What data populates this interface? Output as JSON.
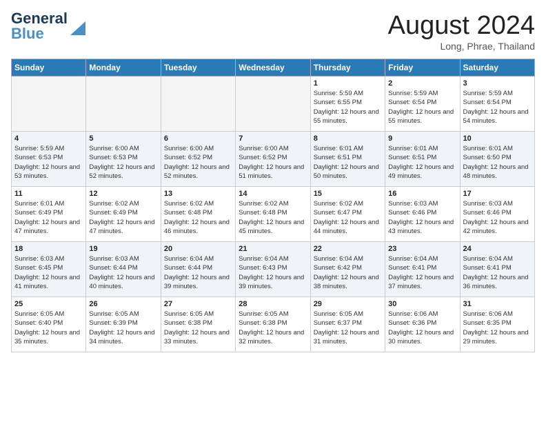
{
  "header": {
    "logo_line1": "General",
    "logo_line2": "Blue",
    "month_year": "August 2024",
    "location": "Long, Phrae, Thailand"
  },
  "days_of_week": [
    "Sunday",
    "Monday",
    "Tuesday",
    "Wednesday",
    "Thursday",
    "Friday",
    "Saturday"
  ],
  "weeks": [
    [
      {
        "day": "",
        "sunrise": "",
        "sunset": "",
        "daylight": ""
      },
      {
        "day": "",
        "sunrise": "",
        "sunset": "",
        "daylight": ""
      },
      {
        "day": "",
        "sunrise": "",
        "sunset": "",
        "daylight": ""
      },
      {
        "day": "",
        "sunrise": "",
        "sunset": "",
        "daylight": ""
      },
      {
        "day": "1",
        "sunrise": "Sunrise: 5:59 AM",
        "sunset": "Sunset: 6:55 PM",
        "daylight": "Daylight: 12 hours and 55 minutes."
      },
      {
        "day": "2",
        "sunrise": "Sunrise: 5:59 AM",
        "sunset": "Sunset: 6:54 PM",
        "daylight": "Daylight: 12 hours and 55 minutes."
      },
      {
        "day": "3",
        "sunrise": "Sunrise: 5:59 AM",
        "sunset": "Sunset: 6:54 PM",
        "daylight": "Daylight: 12 hours and 54 minutes."
      }
    ],
    [
      {
        "day": "4",
        "sunrise": "Sunrise: 5:59 AM",
        "sunset": "Sunset: 6:53 PM",
        "daylight": "Daylight: 12 hours and 53 minutes."
      },
      {
        "day": "5",
        "sunrise": "Sunrise: 6:00 AM",
        "sunset": "Sunset: 6:53 PM",
        "daylight": "Daylight: 12 hours and 52 minutes."
      },
      {
        "day": "6",
        "sunrise": "Sunrise: 6:00 AM",
        "sunset": "Sunset: 6:52 PM",
        "daylight": "Daylight: 12 hours and 52 minutes."
      },
      {
        "day": "7",
        "sunrise": "Sunrise: 6:00 AM",
        "sunset": "Sunset: 6:52 PM",
        "daylight": "Daylight: 12 hours and 51 minutes."
      },
      {
        "day": "8",
        "sunrise": "Sunrise: 6:01 AM",
        "sunset": "Sunset: 6:51 PM",
        "daylight": "Daylight: 12 hours and 50 minutes."
      },
      {
        "day": "9",
        "sunrise": "Sunrise: 6:01 AM",
        "sunset": "Sunset: 6:51 PM",
        "daylight": "Daylight: 12 hours and 49 minutes."
      },
      {
        "day": "10",
        "sunrise": "Sunrise: 6:01 AM",
        "sunset": "Sunset: 6:50 PM",
        "daylight": "Daylight: 12 hours and 48 minutes."
      }
    ],
    [
      {
        "day": "11",
        "sunrise": "Sunrise: 6:01 AM",
        "sunset": "Sunset: 6:49 PM",
        "daylight": "Daylight: 12 hours and 47 minutes."
      },
      {
        "day": "12",
        "sunrise": "Sunrise: 6:02 AM",
        "sunset": "Sunset: 6:49 PM",
        "daylight": "Daylight: 12 hours and 47 minutes."
      },
      {
        "day": "13",
        "sunrise": "Sunrise: 6:02 AM",
        "sunset": "Sunset: 6:48 PM",
        "daylight": "Daylight: 12 hours and 46 minutes."
      },
      {
        "day": "14",
        "sunrise": "Sunrise: 6:02 AM",
        "sunset": "Sunset: 6:48 PM",
        "daylight": "Daylight: 12 hours and 45 minutes."
      },
      {
        "day": "15",
        "sunrise": "Sunrise: 6:02 AM",
        "sunset": "Sunset: 6:47 PM",
        "daylight": "Daylight: 12 hours and 44 minutes."
      },
      {
        "day": "16",
        "sunrise": "Sunrise: 6:03 AM",
        "sunset": "Sunset: 6:46 PM",
        "daylight": "Daylight: 12 hours and 43 minutes."
      },
      {
        "day": "17",
        "sunrise": "Sunrise: 6:03 AM",
        "sunset": "Sunset: 6:46 PM",
        "daylight": "Daylight: 12 hours and 42 minutes."
      }
    ],
    [
      {
        "day": "18",
        "sunrise": "Sunrise: 6:03 AM",
        "sunset": "Sunset: 6:45 PM",
        "daylight": "Daylight: 12 hours and 41 minutes."
      },
      {
        "day": "19",
        "sunrise": "Sunrise: 6:03 AM",
        "sunset": "Sunset: 6:44 PM",
        "daylight": "Daylight: 12 hours and 40 minutes."
      },
      {
        "day": "20",
        "sunrise": "Sunrise: 6:04 AM",
        "sunset": "Sunset: 6:44 PM",
        "daylight": "Daylight: 12 hours and 39 minutes."
      },
      {
        "day": "21",
        "sunrise": "Sunrise: 6:04 AM",
        "sunset": "Sunset: 6:43 PM",
        "daylight": "Daylight: 12 hours and 39 minutes."
      },
      {
        "day": "22",
        "sunrise": "Sunrise: 6:04 AM",
        "sunset": "Sunset: 6:42 PM",
        "daylight": "Daylight: 12 hours and 38 minutes."
      },
      {
        "day": "23",
        "sunrise": "Sunrise: 6:04 AM",
        "sunset": "Sunset: 6:41 PM",
        "daylight": "Daylight: 12 hours and 37 minutes."
      },
      {
        "day": "24",
        "sunrise": "Sunrise: 6:04 AM",
        "sunset": "Sunset: 6:41 PM",
        "daylight": "Daylight: 12 hours and 36 minutes."
      }
    ],
    [
      {
        "day": "25",
        "sunrise": "Sunrise: 6:05 AM",
        "sunset": "Sunset: 6:40 PM",
        "daylight": "Daylight: 12 hours and 35 minutes."
      },
      {
        "day": "26",
        "sunrise": "Sunrise: 6:05 AM",
        "sunset": "Sunset: 6:39 PM",
        "daylight": "Daylight: 12 hours and 34 minutes."
      },
      {
        "day": "27",
        "sunrise": "Sunrise: 6:05 AM",
        "sunset": "Sunset: 6:38 PM",
        "daylight": "Daylight: 12 hours and 33 minutes."
      },
      {
        "day": "28",
        "sunrise": "Sunrise: 6:05 AM",
        "sunset": "Sunset: 6:38 PM",
        "daylight": "Daylight: 12 hours and 32 minutes."
      },
      {
        "day": "29",
        "sunrise": "Sunrise: 6:05 AM",
        "sunset": "Sunset: 6:37 PM",
        "daylight": "Daylight: 12 hours and 31 minutes."
      },
      {
        "day": "30",
        "sunrise": "Sunrise: 6:06 AM",
        "sunset": "Sunset: 6:36 PM",
        "daylight": "Daylight: 12 hours and 30 minutes."
      },
      {
        "day": "31",
        "sunrise": "Sunrise: 6:06 AM",
        "sunset": "Sunset: 6:35 PM",
        "daylight": "Daylight: 12 hours and 29 minutes."
      }
    ]
  ]
}
